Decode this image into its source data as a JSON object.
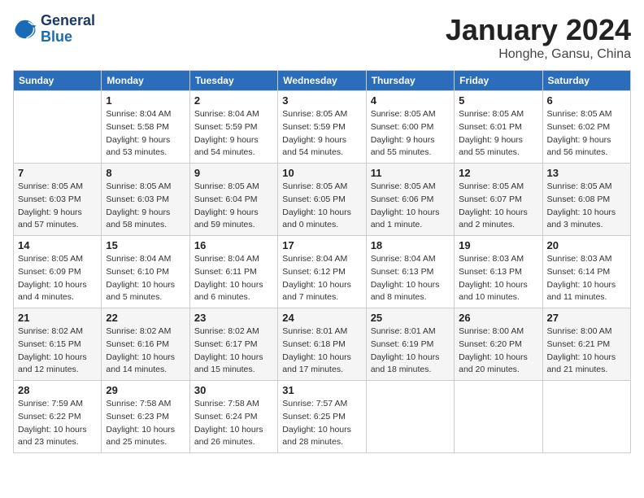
{
  "header": {
    "logo": {
      "general": "General",
      "blue": "Blue"
    },
    "month": "January 2024",
    "location": "Honghe, Gansu, China"
  },
  "weekdays": [
    "Sunday",
    "Monday",
    "Tuesday",
    "Wednesday",
    "Thursday",
    "Friday",
    "Saturday"
  ],
  "weeks": [
    [
      {
        "day": "",
        "info": ""
      },
      {
        "day": "1",
        "info": "Sunrise: 8:04 AM\nSunset: 5:58 PM\nDaylight: 9 hours\nand 53 minutes."
      },
      {
        "day": "2",
        "info": "Sunrise: 8:04 AM\nSunset: 5:59 PM\nDaylight: 9 hours\nand 54 minutes."
      },
      {
        "day": "3",
        "info": "Sunrise: 8:05 AM\nSunset: 5:59 PM\nDaylight: 9 hours\nand 54 minutes."
      },
      {
        "day": "4",
        "info": "Sunrise: 8:05 AM\nSunset: 6:00 PM\nDaylight: 9 hours\nand 55 minutes."
      },
      {
        "day": "5",
        "info": "Sunrise: 8:05 AM\nSunset: 6:01 PM\nDaylight: 9 hours\nand 55 minutes."
      },
      {
        "day": "6",
        "info": "Sunrise: 8:05 AM\nSunset: 6:02 PM\nDaylight: 9 hours\nand 56 minutes."
      }
    ],
    [
      {
        "day": "7",
        "info": "Sunrise: 8:05 AM\nSunset: 6:03 PM\nDaylight: 9 hours\nand 57 minutes."
      },
      {
        "day": "8",
        "info": "Sunrise: 8:05 AM\nSunset: 6:03 PM\nDaylight: 9 hours\nand 58 minutes."
      },
      {
        "day": "9",
        "info": "Sunrise: 8:05 AM\nSunset: 6:04 PM\nDaylight: 9 hours\nand 59 minutes."
      },
      {
        "day": "10",
        "info": "Sunrise: 8:05 AM\nSunset: 6:05 PM\nDaylight: 10 hours\nand 0 minutes."
      },
      {
        "day": "11",
        "info": "Sunrise: 8:05 AM\nSunset: 6:06 PM\nDaylight: 10 hours\nand 1 minute."
      },
      {
        "day": "12",
        "info": "Sunrise: 8:05 AM\nSunset: 6:07 PM\nDaylight: 10 hours\nand 2 minutes."
      },
      {
        "day": "13",
        "info": "Sunrise: 8:05 AM\nSunset: 6:08 PM\nDaylight: 10 hours\nand 3 minutes."
      }
    ],
    [
      {
        "day": "14",
        "info": "Sunrise: 8:05 AM\nSunset: 6:09 PM\nDaylight: 10 hours\nand 4 minutes."
      },
      {
        "day": "15",
        "info": "Sunrise: 8:04 AM\nSunset: 6:10 PM\nDaylight: 10 hours\nand 5 minutes."
      },
      {
        "day": "16",
        "info": "Sunrise: 8:04 AM\nSunset: 6:11 PM\nDaylight: 10 hours\nand 6 minutes."
      },
      {
        "day": "17",
        "info": "Sunrise: 8:04 AM\nSunset: 6:12 PM\nDaylight: 10 hours\nand 7 minutes."
      },
      {
        "day": "18",
        "info": "Sunrise: 8:04 AM\nSunset: 6:13 PM\nDaylight: 10 hours\nand 8 minutes."
      },
      {
        "day": "19",
        "info": "Sunrise: 8:03 AM\nSunset: 6:13 PM\nDaylight: 10 hours\nand 10 minutes."
      },
      {
        "day": "20",
        "info": "Sunrise: 8:03 AM\nSunset: 6:14 PM\nDaylight: 10 hours\nand 11 minutes."
      }
    ],
    [
      {
        "day": "21",
        "info": "Sunrise: 8:02 AM\nSunset: 6:15 PM\nDaylight: 10 hours\nand 12 minutes."
      },
      {
        "day": "22",
        "info": "Sunrise: 8:02 AM\nSunset: 6:16 PM\nDaylight: 10 hours\nand 14 minutes."
      },
      {
        "day": "23",
        "info": "Sunrise: 8:02 AM\nSunset: 6:17 PM\nDaylight: 10 hours\nand 15 minutes."
      },
      {
        "day": "24",
        "info": "Sunrise: 8:01 AM\nSunset: 6:18 PM\nDaylight: 10 hours\nand 17 minutes."
      },
      {
        "day": "25",
        "info": "Sunrise: 8:01 AM\nSunset: 6:19 PM\nDaylight: 10 hours\nand 18 minutes."
      },
      {
        "day": "26",
        "info": "Sunrise: 8:00 AM\nSunset: 6:20 PM\nDaylight: 10 hours\nand 20 minutes."
      },
      {
        "day": "27",
        "info": "Sunrise: 8:00 AM\nSunset: 6:21 PM\nDaylight: 10 hours\nand 21 minutes."
      }
    ],
    [
      {
        "day": "28",
        "info": "Sunrise: 7:59 AM\nSunset: 6:22 PM\nDaylight: 10 hours\nand 23 minutes."
      },
      {
        "day": "29",
        "info": "Sunrise: 7:58 AM\nSunset: 6:23 PM\nDaylight: 10 hours\nand 25 minutes."
      },
      {
        "day": "30",
        "info": "Sunrise: 7:58 AM\nSunset: 6:24 PM\nDaylight: 10 hours\nand 26 minutes."
      },
      {
        "day": "31",
        "info": "Sunrise: 7:57 AM\nSunset: 6:25 PM\nDaylight: 10 hours\nand 28 minutes."
      },
      {
        "day": "",
        "info": ""
      },
      {
        "day": "",
        "info": ""
      },
      {
        "day": "",
        "info": ""
      }
    ]
  ]
}
